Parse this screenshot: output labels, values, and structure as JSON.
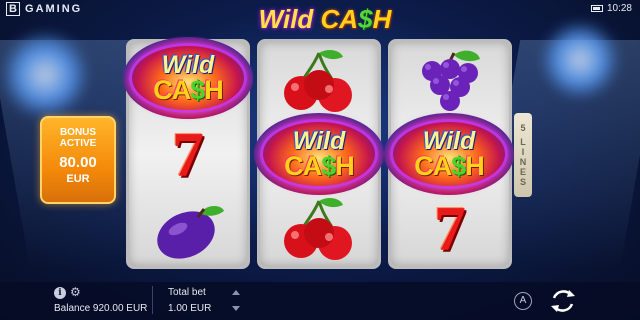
{
  "header": {
    "brand_mark": "B",
    "brand_text": "GAMING",
    "clock": "10:28"
  },
  "game_title": {
    "word1": "Wild",
    "word2_start": "CA",
    "word2_dollar": "$",
    "word2_end": "H"
  },
  "bonus": {
    "line1": "BONUS",
    "line2": "ACTIVE",
    "amount": "80.00",
    "currency": "EUR"
  },
  "lines_indicator": {
    "number": "5",
    "label": "LINES"
  },
  "reels": {
    "reel1": [
      "wild-cash",
      "seven",
      "plum"
    ],
    "reel2": [
      "cherries",
      "wild-cash",
      "cherries"
    ],
    "reel3": [
      "grapes",
      "wild-cash",
      "seven"
    ]
  },
  "symbols": {
    "wild_word": "Wild",
    "cash_start": "CA",
    "cash_dollar": "$",
    "cash_end": "H",
    "seven": "7"
  },
  "footer": {
    "balance_label": "Balance",
    "balance_value": "920.00 EUR",
    "bet_label": "Total bet",
    "bet_value": "1.00 EUR",
    "auto_label": "A",
    "info_glyph": "i"
  },
  "colors": {
    "background": "#0c1c4a",
    "bonus_orange": "#f58a0a",
    "reel_silver": "#e6e6e6",
    "cash_gold": "#ffd21a",
    "dollar_green": "#4bd42a"
  }
}
